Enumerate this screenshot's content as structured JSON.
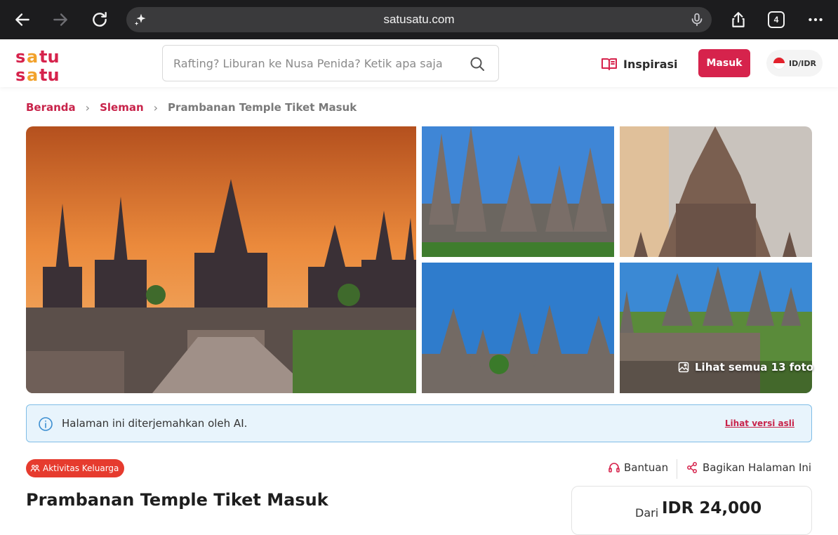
{
  "browser": {
    "url": "satusatu.com",
    "tab_count": "4"
  },
  "header": {
    "logo_text": "satu satu",
    "search_placeholder": "Rafting? Liburan ke Nusa Penida? Ketik apa saja",
    "inspirasi_label": "Inspirasi",
    "login_label": "Masuk",
    "lang_label": "ID/IDR"
  },
  "breadcrumb": {
    "items": [
      "Beranda",
      "Sleman"
    ],
    "current": "Prambanan Temple Tiket Masuk"
  },
  "gallery": {
    "see_all_label": "Lihat semua 13 foto"
  },
  "notice": {
    "text": "Halaman ini diterjemahkan oleh AI.",
    "link": "Lihat versi asli"
  },
  "product": {
    "badge": "Aktivitas Keluarga",
    "help_label": "Bantuan",
    "share_label": "Bagikan Halaman Ini",
    "title": "Prambanan Temple Tiket Masuk",
    "price_prefix": "Dari",
    "price": "IDR 24,000"
  },
  "colors": {
    "brand": "#d6234c",
    "link": "#c8234a",
    "notice_bg": "#e8f4fc",
    "notice_border": "#7fbde6",
    "badge": "#e63b2e"
  }
}
